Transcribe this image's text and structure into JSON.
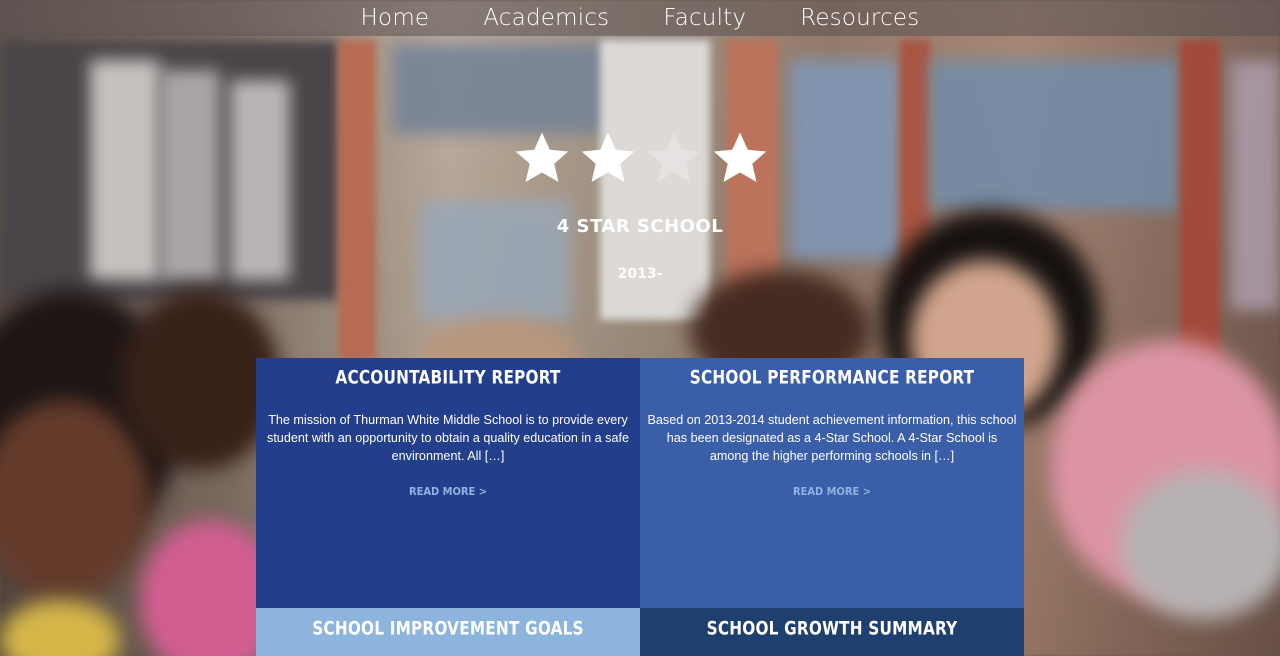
{
  "nav": {
    "items": [
      {
        "label": "Home"
      },
      {
        "label": "Academics"
      },
      {
        "label": "Faculty"
      },
      {
        "label": "Resources"
      }
    ]
  },
  "hero": {
    "stars_filled": 4,
    "title": "4 STAR SCHOOL",
    "year": "2013-"
  },
  "cards": [
    {
      "title": "ACCOUNTABILITY REPORT",
      "text": "The mission of Thurman White Middle School is to provide every student with an opportunity to obtain a quality education in a safe environment. All […]",
      "more": "READ MORE >"
    },
    {
      "title": "SCHOOL PERFORMANCE REPORT",
      "text": "Based on 2013-2014 student achievement information, this school has been designated as a 4-Star School. A 4-Star School is among the higher performing schools in […]",
      "more": "READ MORE >"
    },
    {
      "title": "SCHOOL IMPROVEMENT GOALS"
    },
    {
      "title": "SCHOOL GROWTH SUMMARY"
    }
  ],
  "colors": {
    "card_dark": "#233f8c",
    "card_mid": "#3a5ea8",
    "card_light": "#8db4dc",
    "card_navy": "#1f3f6e",
    "link": "#8fb4e3"
  }
}
